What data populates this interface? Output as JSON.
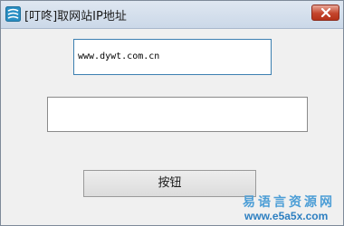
{
  "window": {
    "title": "[叮咚]取网站IP地址",
    "app_icon": "app-logo-icon",
    "close_icon": "close-icon"
  },
  "form": {
    "url_value": "www.dywt.com.cn",
    "result_value": "",
    "button_label": "按钮"
  },
  "watermark": {
    "name": "易语言资源网",
    "url": "www.e5a5x.com"
  },
  "colors": {
    "input_focus_border": "#3c7fb1",
    "close_button": "#c4452c",
    "watermark": "#4d9ed6"
  }
}
